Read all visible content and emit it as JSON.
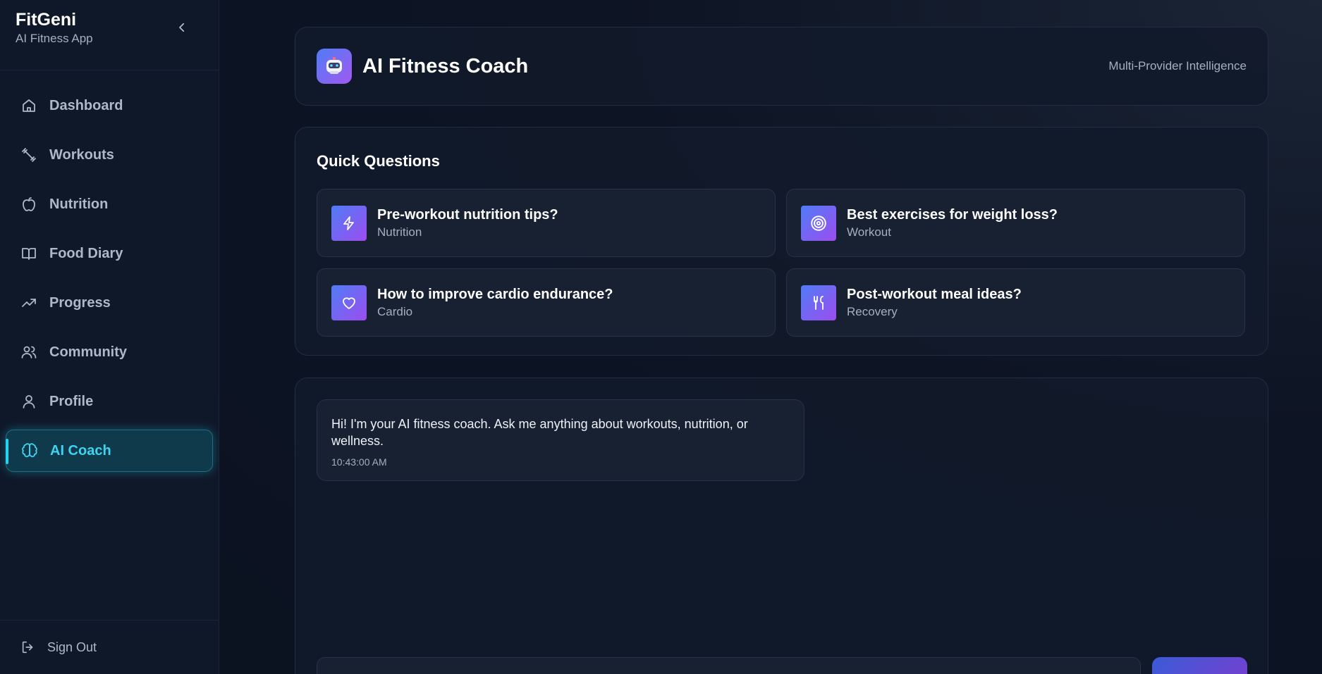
{
  "app": {
    "name": "FitGeni",
    "subtitle": "AI Fitness App"
  },
  "sidebar": {
    "items": [
      {
        "label": "Dashboard",
        "icon": "home-icon",
        "active": false
      },
      {
        "label": "Workouts",
        "icon": "dumbbell-icon",
        "active": false
      },
      {
        "label": "Nutrition",
        "icon": "apple-icon",
        "active": false
      },
      {
        "label": "Food Diary",
        "icon": "book-icon",
        "active": false
      },
      {
        "label": "Progress",
        "icon": "trending-up-icon",
        "active": false
      },
      {
        "label": "Community",
        "icon": "users-icon",
        "active": false
      },
      {
        "label": "Profile",
        "icon": "user-icon",
        "active": false
      },
      {
        "label": "AI Coach",
        "icon": "brain-icon",
        "active": true
      }
    ],
    "sign_out": "Sign Out"
  },
  "header": {
    "title": "AI Fitness Coach",
    "provider": "Multi-Provider Intelligence",
    "avatar_icon": "robot-icon"
  },
  "quick_questions": {
    "title": "Quick Questions",
    "items": [
      {
        "question": "Pre-workout nutrition tips?",
        "category": "Nutrition",
        "icon": "lightning-icon"
      },
      {
        "question": "Best exercises for weight loss?",
        "category": "Workout",
        "icon": "target-icon"
      },
      {
        "question": "How to improve cardio endurance?",
        "category": "Cardio",
        "icon": "heart-icon"
      },
      {
        "question": "Post-workout meal ideas?",
        "category": "Recovery",
        "icon": "utensils-icon"
      }
    ]
  },
  "chat": {
    "messages": [
      {
        "text": "Hi! I'm your AI fitness coach. Ask me anything about workouts, nutrition, or wellness.",
        "time": "10:43:00 AM"
      }
    ],
    "input_value": "",
    "send_label": ""
  },
  "colors": {
    "accent": "#22d3ee",
    "gradient_start": "#4f7cf6",
    "gradient_end": "#a259f0",
    "background": "#0d1424"
  }
}
